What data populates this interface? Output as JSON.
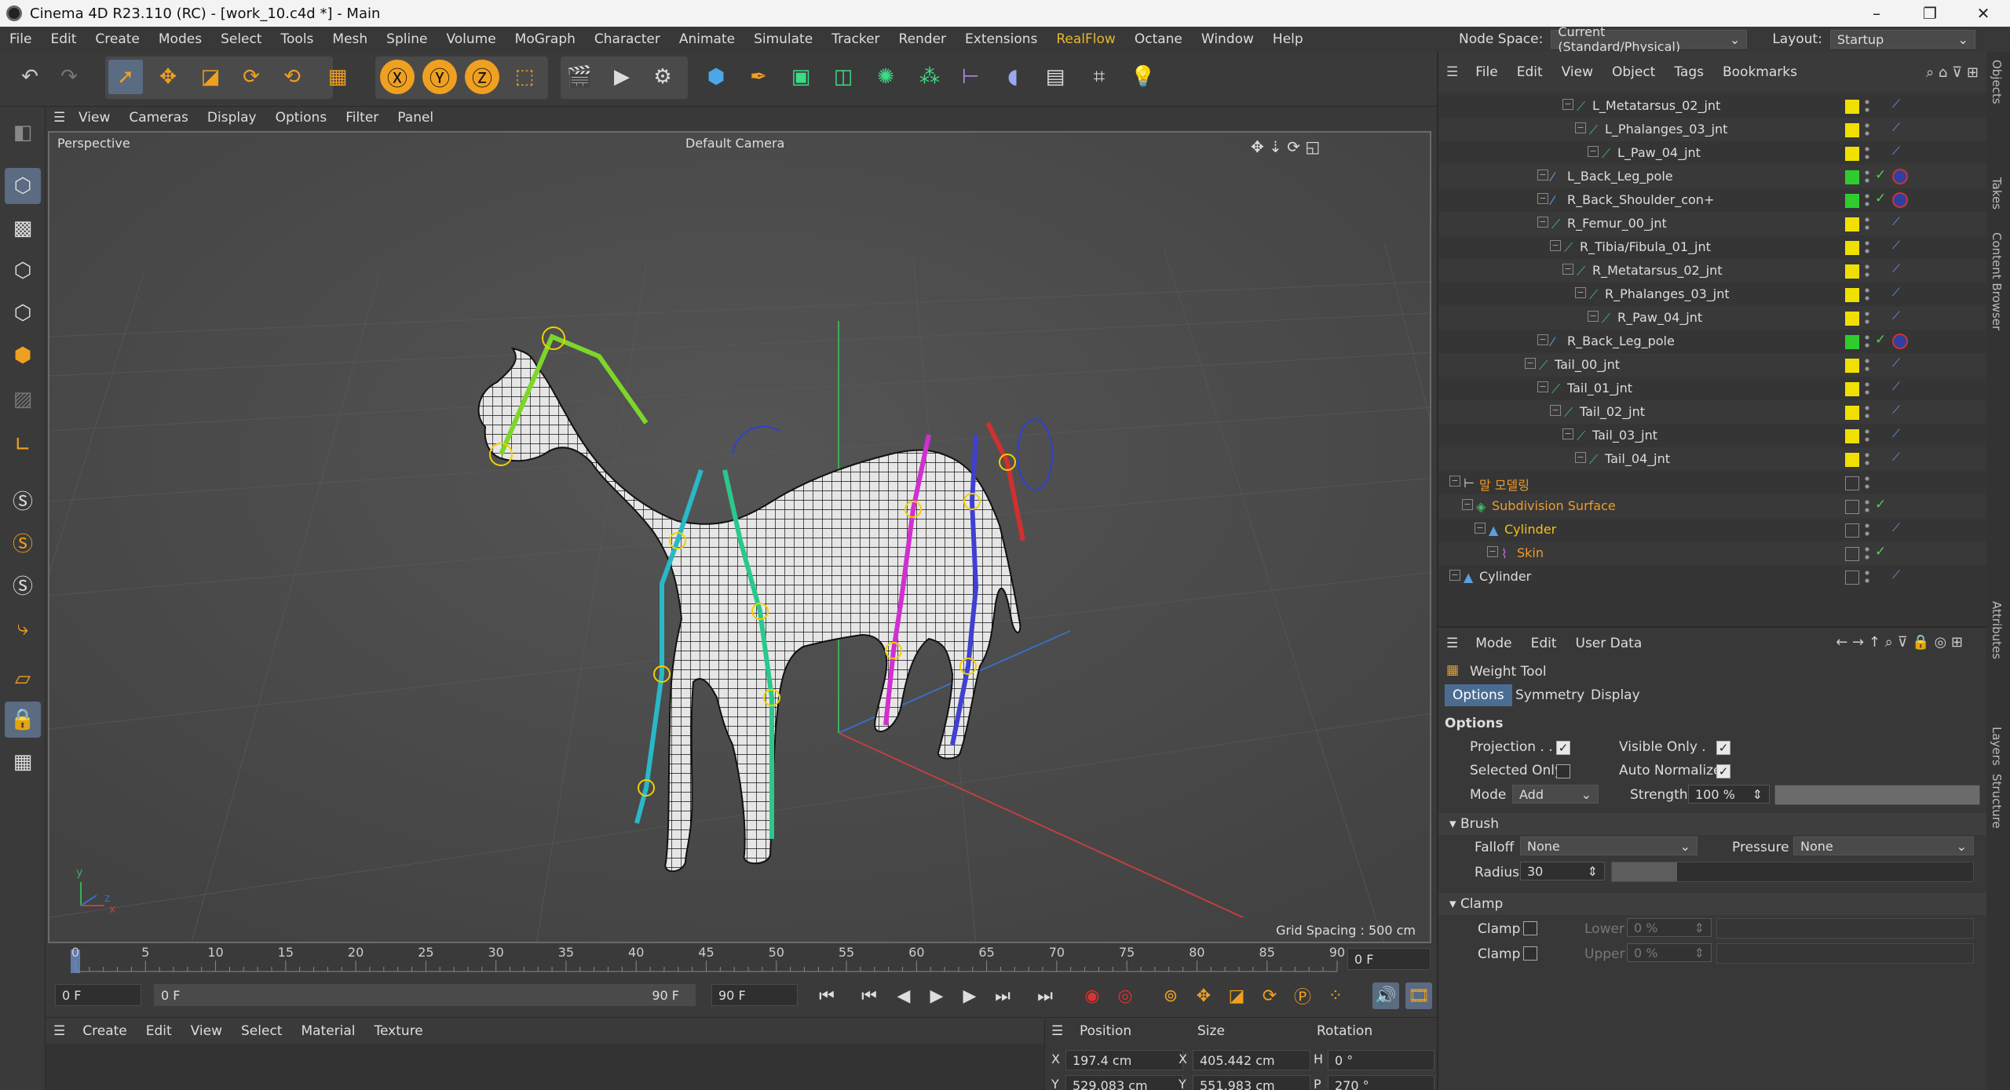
{
  "window": {
    "title": "Cinema 4D R23.110 (RC) - [work_10.c4d *] - Main",
    "min": "–",
    "max": "❐",
    "close": "✕"
  },
  "menubar": [
    "File",
    "Edit",
    "Create",
    "Modes",
    "Select",
    "Tools",
    "Mesh",
    "Spline",
    "Volume",
    "MoGraph",
    "Character",
    "Animate",
    "Simulate",
    "Tracker",
    "Render",
    "Extensions",
    "RealFlow",
    "Octane",
    "Window",
    "Help"
  ],
  "menubar_highlight": "RealFlow",
  "nodespace": {
    "label": "Node Space:",
    "value": "Current (Standard/Physical)",
    "layout_label": "Layout:",
    "layout_value": "Startup"
  },
  "viewport": {
    "menu": [
      "View",
      "Cameras",
      "Display",
      "Options",
      "Filter",
      "Panel"
    ],
    "name": "Perspective",
    "camera": "Default Camera",
    "grid_spacing": "Grid Spacing : 500 cm",
    "axis_y": "y",
    "axis_z": "z",
    "axis_x": "x"
  },
  "timeline": {
    "ticks": [
      "0",
      "5",
      "10",
      "15",
      "20",
      "25",
      "30",
      "35",
      "40",
      "45",
      "50",
      "55",
      "60",
      "65",
      "70",
      "75",
      "80",
      "85",
      "90"
    ],
    "current_frame": "0 F"
  },
  "transport": {
    "start": "0 F",
    "range_start": "0 F",
    "range_end": "90 F",
    "end": "90 F"
  },
  "material_menu": [
    "Create",
    "Edit",
    "View",
    "Select",
    "Material",
    "Texture"
  ],
  "coords": {
    "headers": [
      "Position",
      "Size",
      "Rotation"
    ],
    "rows": [
      {
        "axis1": "X",
        "pos": "197.4 cm",
        "axis2": "X",
        "size": "405.442 cm",
        "axis3": "H",
        "rot": "0 °"
      },
      {
        "axis1": "Y",
        "pos": "529.083 cm",
        "axis2": "Y",
        "size": "551.983 cm",
        "axis3": "P",
        "rot": "270 °"
      }
    ]
  },
  "object_manager": {
    "menu": [
      "File",
      "Edit",
      "View",
      "Object",
      "Tags",
      "Bookmarks"
    ],
    "rows": [
      {
        "label": "L_Metatarsus_02_jnt",
        "indent": 9,
        "type": "joint",
        "color": "#f0e000"
      },
      {
        "label": "L_Phalanges_03_jnt",
        "indent": 10,
        "type": "joint",
        "color": "#f0e000"
      },
      {
        "label": "L_Paw_04_jnt",
        "indent": 11,
        "type": "joint",
        "color": "#f0e000"
      },
      {
        "label": "L_Back_Leg_pole",
        "indent": 7,
        "type": "pole",
        "color": "#2fcc2f"
      },
      {
        "label": "R_Back_Shoulder_con+",
        "indent": 7,
        "type": "pole",
        "color": "#2fcc2f"
      },
      {
        "label": "R_Femur_00_jnt",
        "indent": 7,
        "type": "joint",
        "color": "#f0e000"
      },
      {
        "label": "R_Tibia/Fibula_01_jnt",
        "indent": 8,
        "type": "joint",
        "color": "#f0e000"
      },
      {
        "label": "R_Metatarsus_02_jnt",
        "indent": 9,
        "type": "joint",
        "color": "#f0e000"
      },
      {
        "label": "R_Phalanges_03_jnt",
        "indent": 10,
        "type": "joint",
        "color": "#f0e000"
      },
      {
        "label": "R_Paw_04_jnt",
        "indent": 11,
        "type": "joint",
        "color": "#f0e000"
      },
      {
        "label": "R_Back_Leg_pole",
        "indent": 7,
        "type": "pole",
        "color": "#2fcc2f"
      },
      {
        "label": "Tail_00_jnt",
        "indent": 6,
        "type": "joint",
        "color": "#f0e000"
      },
      {
        "label": "Tail_01_jnt",
        "indent": 7,
        "type": "joint",
        "color": "#f0e000"
      },
      {
        "label": "Tail_02_jnt",
        "indent": 8,
        "type": "joint",
        "color": "#f0e000"
      },
      {
        "label": "Tail_03_jnt",
        "indent": 9,
        "type": "joint",
        "color": "#f0e000"
      },
      {
        "label": "Tail_04_jnt",
        "indent": 10,
        "type": "joint",
        "color": "#f0e000"
      },
      {
        "label": "말 모델링",
        "indent": 0,
        "type": "null",
        "orange": true
      },
      {
        "label": "Subdivision Surface",
        "indent": 1,
        "type": "subd",
        "orange": true
      },
      {
        "label": "Cylinder",
        "indent": 2,
        "type": "cyl",
        "orange": false,
        "yellow": true
      },
      {
        "label": "Skin",
        "indent": 3,
        "type": "skin",
        "orange": true
      },
      {
        "label": "Cylinder",
        "indent": 0,
        "type": "cyl"
      }
    ]
  },
  "attributes": {
    "menu": [
      "Mode",
      "Edit",
      "User Data"
    ],
    "tool": "Weight Tool",
    "tabs": [
      "Options",
      "Symmetry",
      "Display"
    ],
    "options_header": "Options",
    "projection": "Projection . .",
    "visible_only": "Visible Only .",
    "selected_only": "Selected Only",
    "auto_normalize": "Auto Normalize",
    "mode_label": "Mode",
    "mode_value": "Add",
    "strength_label": "Strength",
    "strength_value": "100 %",
    "strength_fraction": 1.0,
    "brush_header": "Brush",
    "falloff_label": "Falloff",
    "falloff_value": "None",
    "pressure_label": "Pressure",
    "pressure_value": "None",
    "radius_label": "Radius",
    "radius_value": "30",
    "clamp_header": "Clamp",
    "clamp_label": "Clamp",
    "lower_label": "Lower",
    "lower_value": "0 %",
    "upper_label": "Upper",
    "upper_value": "0 %"
  },
  "side_tabs": [
    "Objects",
    "Takes",
    "Content Browser",
    "Attributes",
    "Layers",
    "Structure"
  ],
  "colors": {
    "accent": "#4b6d94",
    "joint_yellow": "#f0e000",
    "layer_green": "#2fcc2f",
    "orange": "#f09a2a"
  }
}
